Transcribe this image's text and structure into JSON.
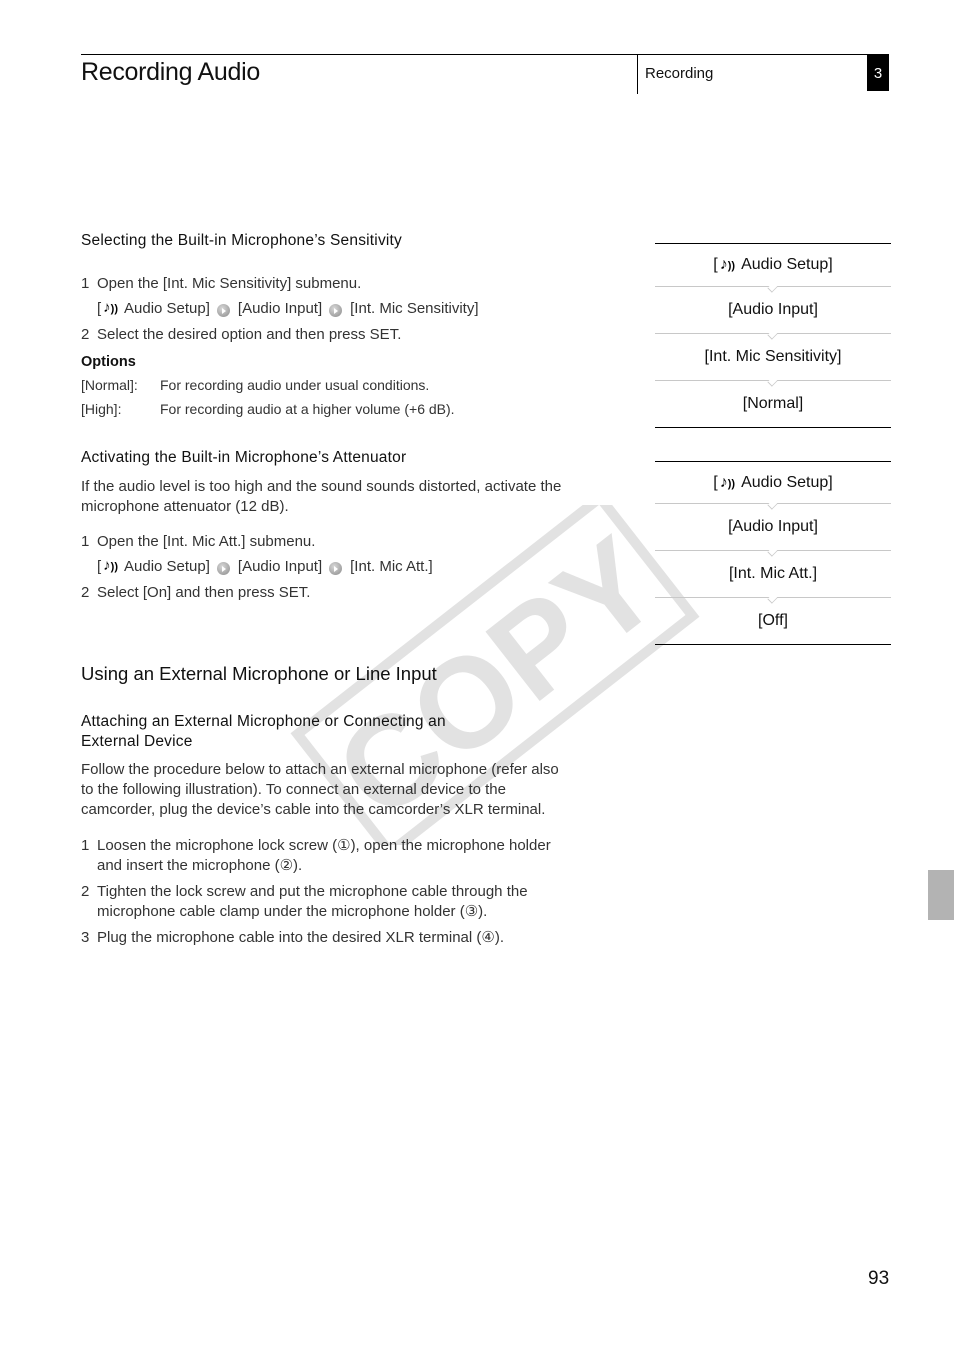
{
  "header": {
    "title": "Recording Audio",
    "section": "Recording",
    "chapter": "3"
  },
  "sensitivity": {
    "heading": "Selecting the Built-in Microphone’s Sensitivity",
    "step1": {
      "num": "1",
      "text": "Open the [Int. Mic Sensitivity] submenu."
    },
    "path": {
      "p1_open": "[",
      "icon": "audio-setup-icon",
      "p1": "Audio Setup]",
      "p2": "[Audio Input]",
      "p3": "[Int. Mic Sensitivity]"
    },
    "step2": {
      "num": "2",
      "text": "Select the desired option and then press SET."
    },
    "options_label": "Options",
    "options": [
      {
        "key": "[Normal]:",
        "desc": "For recording audio under usual conditions."
      },
      {
        "key": "[High]:",
        "desc": "For recording audio at a higher volume (+6 dB)."
      }
    ],
    "menu": [
      "Audio Setup]",
      "[Audio Input]",
      "[Int. Mic Sensitivity]",
      "[Normal]"
    ]
  },
  "attenuator": {
    "heading": "Activating the Built-in Microphone’s Attenuator",
    "intro_line1": "If the audio level is too high and the sound sounds distorted, activate the",
    "intro_line2": "microphone attenuator (12 dB).",
    "step1": {
      "num": "1",
      "text": "Open the [Int. Mic Att.] submenu."
    },
    "path": {
      "p1_open": "[",
      "p1": "Audio Setup]",
      "p2": "[Audio Input]",
      "p3": "[Int. Mic Att.]"
    },
    "step2": {
      "num": "2",
      "text": "Select [On] and then press SET."
    },
    "menu": [
      "Audio Setup]",
      "[Audio Input]",
      "[Int. Mic Att.]",
      "[Off]"
    ]
  },
  "external": {
    "heading": "Using an External Microphone or Line Input",
    "subheading_line1": "Attaching an External Microphone or Connecting an",
    "subheading_line2": "External Device",
    "intro_line1": "Follow the procedure below to attach an external microphone (refer also",
    "intro_line2": "to the following illustration). To connect an external device to the",
    "intro_line3": "camcorder, plug the device’s cable into the camcorder’s XLR terminal.",
    "steps": [
      {
        "num": "1",
        "line1": "Loosen the microphone lock screw (①), open the microphone holder",
        "line2": "and insert the microphone (②)."
      },
      {
        "num": "2",
        "line1": "Tighten the lock screw and put the microphone cable through the",
        "line2": "microphone cable clamp under the microphone holder (③)."
      },
      {
        "num": "3",
        "line1": "Plug the microphone cable into the desired XLR terminal (④).",
        "line2": ""
      }
    ]
  },
  "watermark": "COPY",
  "page_number": "93",
  "colors": {
    "watermark": "#e2e2e2",
    "side_tab": "#b3b3b3",
    "text": "#222222"
  }
}
